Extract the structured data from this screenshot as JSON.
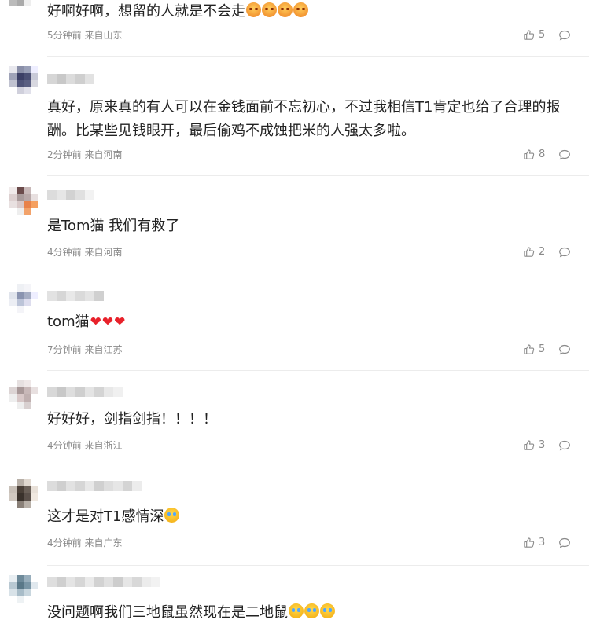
{
  "comments": [
    {
      "id": 1,
      "text": "好啊好啊，想留的人就是不会走",
      "emoji_count": 4,
      "emoji_type": "angry",
      "time_location": "5分钟前 来自山东",
      "likes": "5"
    },
    {
      "id": 2,
      "text": "真好，原来真的有人可以在金钱面前不忘初心，不过我相信T1肯定也给了合理的报酬。比某些见钱眼开，最后偷鸡不成蚀把米的人强太多啦。",
      "time_location": "2分钟前 来自河南",
      "likes": "8"
    },
    {
      "id": 3,
      "text": "是Tom猫 我们有救了",
      "time_location": "4分钟前 来自河南",
      "likes": "2"
    },
    {
      "id": 4,
      "text": "tom猫",
      "hearts": 3,
      "time_location": "7分钟前 来自江苏",
      "likes": "5"
    },
    {
      "id": 5,
      "text": "好好好，剑指剑指！！！！",
      "time_location": "4分钟前 来自浙江",
      "likes": "3"
    },
    {
      "id": 6,
      "text": "这才是对T1感情深",
      "emoji_count": 1,
      "emoji_type": "cry",
      "time_location": "4分钟前 来自广东",
      "likes": "3"
    },
    {
      "id": 7,
      "text": "没问题啊我们三地鼠虽然现在是二地鼠",
      "emoji_count": 3,
      "emoji_type": "cry",
      "time_location": "",
      "likes": ""
    }
  ],
  "icons": {
    "like": "thumbs-up-icon",
    "reply": "comment-bubble-icon",
    "emoji": "crying-face-emoji",
    "heart": "red-heart-emoji"
  },
  "colors": {
    "text": "#222222",
    "meta": "#8a8a8a",
    "separator": "#ececec",
    "heart": "#e8212a"
  }
}
